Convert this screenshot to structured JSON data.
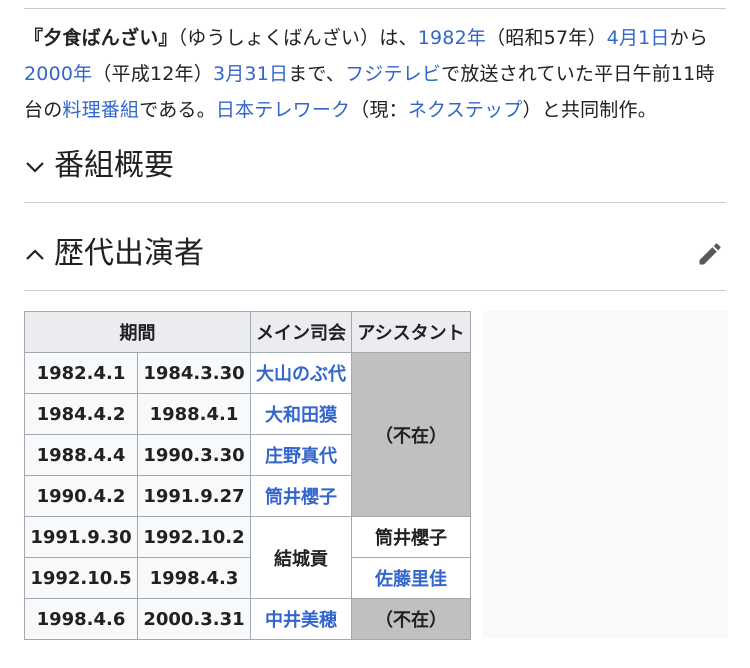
{
  "intro": [
    {
      "text": "『夕食ばんざい』",
      "bold": true
    },
    {
      "text": "（ゆうしょくばんざい）は、"
    },
    {
      "text": "1982年",
      "link": true
    },
    {
      "text": "（昭和57年）"
    },
    {
      "text": "4月1日",
      "link": true
    },
    {
      "text": "から"
    },
    {
      "text": "2000年",
      "link": true
    },
    {
      "text": "（平成12年）"
    },
    {
      "text": "3月31日",
      "link": true
    },
    {
      "text": "まで、"
    },
    {
      "text": "フジテレビ",
      "link": true
    },
    {
      "text": "で放送されていた平日午前11時台の"
    },
    {
      "text": "料理番組",
      "link": true
    },
    {
      "text": "である。"
    },
    {
      "text": "日本テレワーク",
      "link": true
    },
    {
      "text": "（現："
    },
    {
      "text": "ネクステップ",
      "link": true
    },
    {
      "text": "）と共同制作。"
    }
  ],
  "sections": {
    "overview": {
      "title": "番組概要",
      "expanded": false
    },
    "cast": {
      "title": "歴代出演者",
      "expanded": true
    }
  },
  "table": {
    "headers": {
      "period": "期間",
      "host": "メイン司会",
      "assistant": "アシスタント"
    },
    "rows": [
      {
        "start": "1982.4.1",
        "end": "1984.3.30",
        "host": "大山のぶ代"
      },
      {
        "start": "1984.4.2",
        "end": "1988.4.1",
        "host": "大和田獏"
      },
      {
        "start": "1988.4.4",
        "end": "1990.3.30",
        "host": "庄野真代"
      },
      {
        "start": "1990.4.2",
        "end": "1991.9.27",
        "host": "筒井櫻子"
      },
      {
        "start": "1991.9.30",
        "end": "1992.10.2"
      },
      {
        "start": "1992.10.5",
        "end": "1998.4.3"
      },
      {
        "start": "1998.4.6",
        "end": "2000.3.31",
        "host": "中井美穂"
      }
    ],
    "merged_host": "結城貢",
    "assistant_absent_1": "（不在）",
    "assistant_a": "筒井櫻子",
    "assistant_b": "佐藤里佳",
    "assistant_absent_2": "（不在）"
  },
  "colors": {
    "link": "#3366cc",
    "text": "#202122",
    "absent_cell": "#c0c0c0",
    "header_bg": "#eaecf0"
  }
}
